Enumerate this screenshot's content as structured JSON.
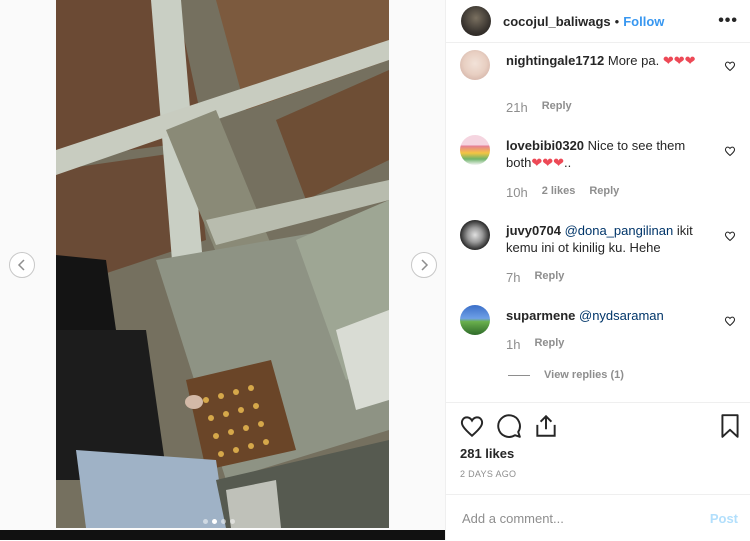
{
  "post": {
    "username": "cocojul_baliwags",
    "separator": "•",
    "follow_label": "Follow",
    "more_label": "•••"
  },
  "carousel": {
    "slide_count": 4,
    "active_index": 1
  },
  "comments": [
    {
      "username": "nightingale1712",
      "text": "More pa.",
      "hearts": 3,
      "time": "21h",
      "likes": "",
      "reply_label": "Reply"
    },
    {
      "username": "lovebibi0320",
      "text": "Nice to see them both",
      "hearts": 3,
      "suffix": "..",
      "time": "10h",
      "likes": "2 likes",
      "reply_label": "Reply"
    },
    {
      "username": "juvy0704",
      "mention": "@dona_pangilinan",
      "text": "ikit kemu ini ot kinilig ku. Hehe",
      "time": "7h",
      "likes": "",
      "reply_label": "Reply"
    },
    {
      "username": "suparmene",
      "mention": "@nydsaraman",
      "text": "",
      "time": "1h",
      "likes": "",
      "reply_label": "Reply"
    }
  ],
  "view_replies_label": "View replies (1)",
  "likes_count": "281 likes",
  "date": "2 DAYS AGO",
  "add_comment": {
    "placeholder": "Add a comment...",
    "post_label": "Post"
  },
  "colors": {
    "accent": "#3897f0",
    "heart": "#ed4956",
    "muted": "#8e8e8e",
    "post_disabled": "#b2dffc"
  }
}
